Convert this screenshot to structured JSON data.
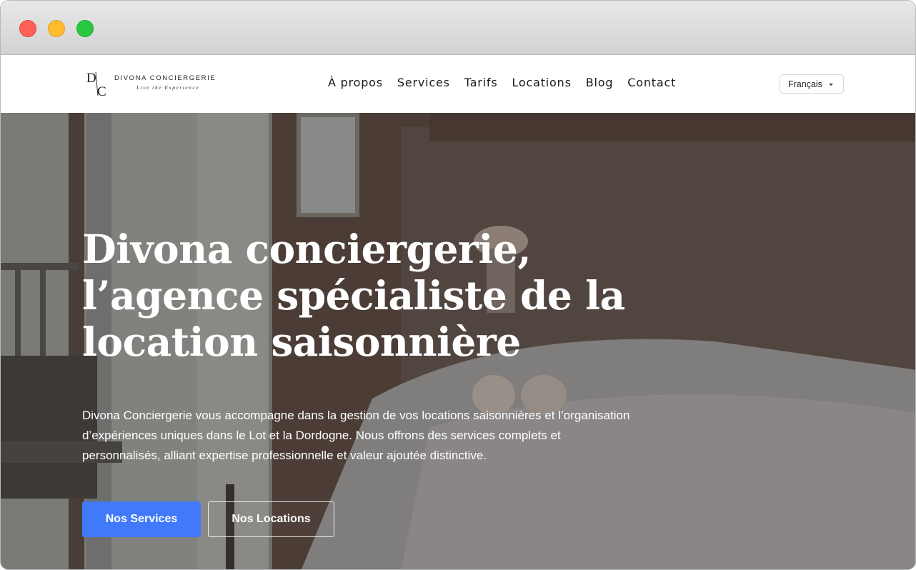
{
  "window": {
    "controls": [
      "close",
      "minimize",
      "maximize"
    ]
  },
  "header": {
    "logo": {
      "mark": "D/C",
      "name": "DIVONA CONCIERGERIE",
      "tagline": "Live the Experience"
    },
    "nav": [
      "À propos",
      "Services",
      "Tarifs",
      "Locations",
      "Blog",
      "Contact"
    ],
    "language": "Français"
  },
  "hero": {
    "title_lines": [
      "Divona conciergerie,",
      "l’agence spécialiste de la",
      "location saisonnière"
    ],
    "description_lines": [
      "Divona Conciergerie vous accompagne dans la gestion de vos locations saisonnières et l’organisation",
      "d’expériences uniques dans le Lot et la Dordogne. Nous offrons des services complets et",
      "personnalisés, alliant expertise professionnelle et valeur ajoutée distinctive."
    ],
    "primary_button": "Nos Services",
    "secondary_button": "Nos Locations"
  },
  "colors": {
    "accent": "#4079f9",
    "traffic_close": "#fe5f57",
    "traffic_minimize": "#febc2e",
    "traffic_maximize": "#28c840"
  }
}
